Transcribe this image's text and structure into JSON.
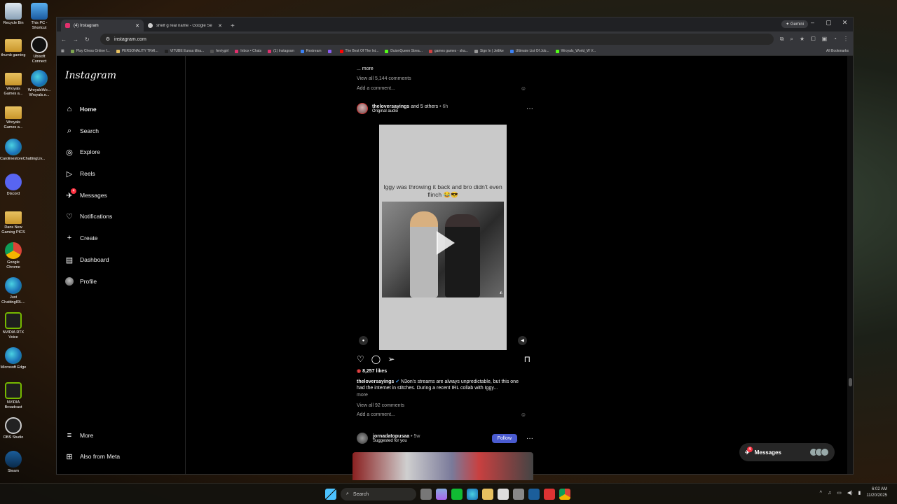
{
  "desktop": {
    "icons": [
      {
        "label": "Recycle Bin",
        "type": "bin"
      },
      {
        "label": "This PC - Shortcut",
        "type": "pc"
      },
      {
        "label": "thumb gaming",
        "type": "folder"
      },
      {
        "label": "Ubisoft Connect",
        "type": "ubi"
      },
      {
        "label": "Wroyals Games a...",
        "type": "folder"
      },
      {
        "label": "WroyalsWo... Wroyals.e...",
        "type": "edge"
      },
      {
        "label": "Wroyals Games a...",
        "type": "folder"
      },
      {
        "label": "CarolinestoreChattingLiv...",
        "type": "edge"
      },
      {
        "label": "Discord",
        "type": "discord"
      },
      {
        "label": "Dans New Gaming PICS",
        "type": "folder"
      },
      {
        "label": "Google Chrome",
        "type": "chrome"
      },
      {
        "label": "Just ChattingIRL...",
        "type": "edge"
      },
      {
        "label": "NVIDIA RTX Voice",
        "type": "nvidia"
      },
      {
        "label": "Microsoft Edge",
        "type": "edge"
      },
      {
        "label": "NVIDIA Broadcast",
        "type": "nvidia"
      },
      {
        "label": "OBS Studio",
        "type": "obs"
      },
      {
        "label": "Steam",
        "type": "steam"
      }
    ]
  },
  "browser": {
    "tabs": [
      {
        "title": "(4) Instagram",
        "active": true,
        "color": "#e1306c"
      },
      {
        "title": "shelf g real name - Google Sea...",
        "active": false,
        "color": "#cccccc"
      }
    ],
    "gemini_label": "Gemini",
    "url": "instagram.com",
    "bookmarks": [
      {
        "label": "Play Chess Online f...",
        "color": "#7fa650"
      },
      {
        "label": "PERSONALITY TRAI...",
        "color": "#e8c160"
      },
      {
        "label": "VITUBE Eunsa tiltra...",
        "color": "#222222"
      },
      {
        "label": "ferrtygirl",
        "color": "#555555"
      },
      {
        "label": "Inbox • Chats",
        "color": "#e1306c"
      },
      {
        "label": "(1) Instagram",
        "color": "#e1306c"
      },
      {
        "label": "Restream",
        "color": "#3b82f6"
      },
      {
        "label": "",
        "color": "#8b5cf6"
      },
      {
        "label": "The Best Of The Int...",
        "color": "#ff0000"
      },
      {
        "label": "DuionQueen Strea...",
        "color": "#53fc18"
      },
      {
        "label": "games games - sha...",
        "color": "#d04040"
      },
      {
        "label": "Sign In | Jetlike",
        "color": "#999999"
      },
      {
        "label": "Ultimate List Of Job...",
        "color": "#3b82f6"
      },
      {
        "label": "Wroyals_World_W V...",
        "color": "#53fc18"
      }
    ],
    "all_bookmarks": "All Bookmarks"
  },
  "sidebar": {
    "logo": "Instagram",
    "items": [
      {
        "label": "Home",
        "icon": "home-icon",
        "glyph": "⌂",
        "bold": true
      },
      {
        "label": "Search",
        "icon": "search-icon",
        "glyph": "⌕"
      },
      {
        "label": "Explore",
        "icon": "compass-icon",
        "glyph": "◎"
      },
      {
        "label": "Reels",
        "icon": "reels-icon",
        "glyph": "▷"
      },
      {
        "label": "Messages",
        "icon": "messenger-icon",
        "glyph": "✈",
        "badge": "4"
      },
      {
        "label": "Notifications",
        "icon": "heart-icon",
        "glyph": "♡"
      },
      {
        "label": "Create",
        "icon": "plus-icon",
        "glyph": "+"
      },
      {
        "label": "Dashboard",
        "icon": "dashboard-icon",
        "glyph": "▤"
      },
      {
        "label": "Profile",
        "icon": "avatar",
        "glyph": ""
      }
    ],
    "more": "More",
    "also_from_meta": "Also from Meta"
  },
  "feed": {
    "prev_post": {
      "more": "... more",
      "view_comments": "View all 5,144 comments",
      "add_comment": "Add a comment..."
    },
    "post": {
      "username": "theloversayings",
      "with": "and 5 others",
      "time": "• 6h",
      "audio": "Original audio",
      "overlay_text": "Iggy was throwing it back and bro didn't even flinch 😂😎",
      "likes": "8,257 likes",
      "caption_user": "theloversayings",
      "caption": "N3on's streams are always unpredictable, but this one had the internet in stitches. During a recent IRL collab with Iggy...",
      "more": "more",
      "view_comments": "View all 92 comments",
      "add_comment": "Add a comment..."
    },
    "next_post": {
      "username": "jornadatopusaa",
      "time": "• 5w",
      "subtitle": "Suggested for you",
      "follow": "Follow"
    }
  },
  "messages_pill": {
    "label": "Messages",
    "badge": "4"
  },
  "taskbar": {
    "search": "Search",
    "time": "6:02 AM",
    "date": "11/20/2025"
  }
}
